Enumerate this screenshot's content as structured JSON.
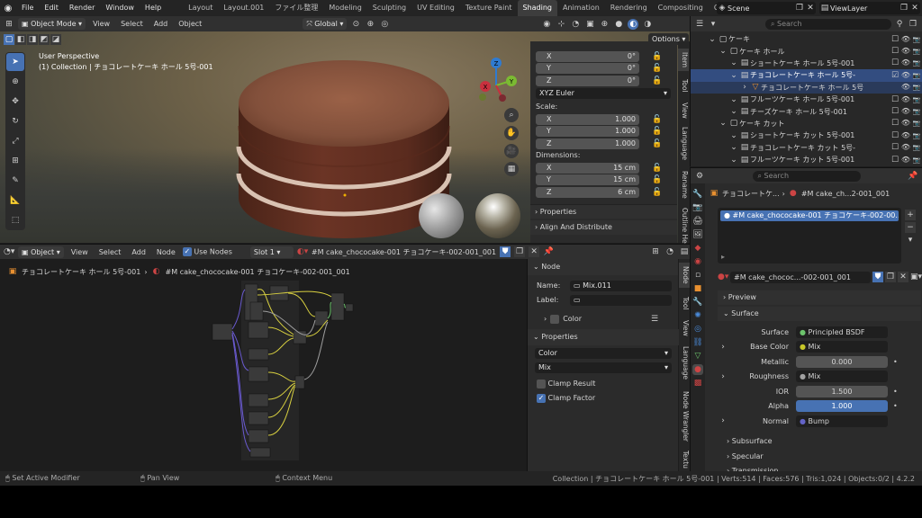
{
  "menu": [
    "File",
    "Edit",
    "Render",
    "Window",
    "Help"
  ],
  "workspace_tabs": [
    "Layout",
    "Layout.001",
    "ファイル整理",
    "Modeling",
    "Sculpting",
    "UV Editing",
    "Texture Paint",
    "Shading",
    "Animation",
    "Rendering",
    "Compositing",
    "Geometry Nodes"
  ],
  "active_tab": "Shading",
  "scene": {
    "label": "Scene",
    "view_layer": "ViewLayer"
  },
  "viewport": {
    "mode": "Object Mode",
    "menus": [
      "View",
      "Select",
      "Add",
      "Object"
    ],
    "orientation": "Global",
    "perspective": "User Perspective",
    "collection_info": "(1) Collection | チョコレートケーキ ホール 5号-001",
    "options": "Options",
    "gizmo": {
      "x": "X",
      "y": "Y",
      "z": "Z"
    }
  },
  "npanel": {
    "rotation": [
      {
        "axis": "X",
        "value": "0°"
      },
      {
        "axis": "Y",
        "value": "0°"
      },
      {
        "axis": "Z",
        "value": "0°"
      }
    ],
    "rotation_mode": "XYZ Euler",
    "scale_label": "Scale:",
    "scale": [
      {
        "axis": "X",
        "value": "1.000"
      },
      {
        "axis": "Y",
        "value": "1.000"
      },
      {
        "axis": "Z",
        "value": "1.000"
      }
    ],
    "dimensions_label": "Dimensions:",
    "dimensions": [
      {
        "axis": "X",
        "value": "15 cm"
      },
      {
        "axis": "Y",
        "value": "15 cm"
      },
      {
        "axis": "Z",
        "value": "6 cm"
      }
    ],
    "properties": "Properties",
    "align": "Align And Distribute",
    "tabs": [
      "Item",
      "Tool",
      "View",
      "Language",
      "Rename",
      "Outline He"
    ]
  },
  "outliner": {
    "search_placeholder": "Search",
    "rows": [
      {
        "indent": 0,
        "text": "ケーキ",
        "icon": "collection"
      },
      {
        "indent": 1,
        "text": "ケーキ ホール",
        "icon": "collection"
      },
      {
        "indent": 2,
        "text": "ショートケーキ ホール 5号-001",
        "icon": "object"
      },
      {
        "indent": 2,
        "text": "チョコレートケーキ ホール 5号-",
        "icon": "object",
        "selected": true
      },
      {
        "indent": 3,
        "text": "チョコレートケーキ ホール 5号",
        "icon": "material",
        "active": true
      },
      {
        "indent": 2,
        "text": "フルーツケーキ ホール 5号-001",
        "icon": "object"
      },
      {
        "indent": 2,
        "text": "チーズケーキ ホール 5号-001",
        "icon": "object"
      },
      {
        "indent": 1,
        "text": "ケーキ カット",
        "icon": "collection"
      },
      {
        "indent": 2,
        "text": "ショートケーキ カット 5号-001",
        "icon": "object"
      },
      {
        "indent": 2,
        "text": "チョコレートケーキ カット 5号-",
        "icon": "object"
      },
      {
        "indent": 2,
        "text": "フルーツケーキ カット 5号-001",
        "icon": "object"
      },
      {
        "indent": 2,
        "text": "チーズケーキ カット 5号-001",
        "icon": "object"
      }
    ]
  },
  "properties": {
    "search_placeholder": "Search",
    "breadcrumb_obj": "チョコレートケ...",
    "breadcrumb_mat": "#M cake_ch...2-001_001",
    "slot": "#M cake_chococake-001 チョコケーキ-002-00...",
    "material_name": "#M cake_chococ...-002-001_001",
    "preview": "Preview",
    "surface": "Surface",
    "fields": [
      {
        "label": "Surface",
        "value": "Principled BSDF",
        "dot": "#6cc36c",
        "kind": "node"
      },
      {
        "label": "Base Color",
        "value": "Mix",
        "dot": "#c7c729",
        "kind": "node"
      },
      {
        "label": "Metallic",
        "value": "0.000",
        "kind": "num"
      },
      {
        "label": "Roughness",
        "value": "Mix",
        "dot": "#a1a1a1",
        "kind": "node"
      },
      {
        "label": "IOR",
        "value": "1.500",
        "kind": "num"
      },
      {
        "label": "Alpha",
        "value": "1.000",
        "kind": "blue"
      },
      {
        "label": "Normal",
        "value": "Bump",
        "dot": "#6363c7",
        "kind": "node"
      }
    ],
    "subsections": [
      "Subsurface",
      "Specular",
      "Transmission"
    ]
  },
  "node_editor": {
    "type": "Object",
    "menus": [
      "View",
      "Select",
      "Add",
      "Node"
    ],
    "use_nodes": "Use Nodes",
    "slot": "Slot 1",
    "material": "#M cake_chococake-001 チョコケーキ-002-001_001",
    "breadcrumb_obj": "チョコレートケーキ ホール 5号-001",
    "breadcrumb_mat": "#M cake_chococake-001 チョコケーキ-002-001_001"
  },
  "node_panel": {
    "title": "Node",
    "name_label": "Name:",
    "name_value": "Mix.011",
    "label_label": "Label:",
    "color": "Color",
    "properties": "Properties",
    "data_type": "Color",
    "blend": "Mix",
    "clamp_result": "Clamp Result",
    "clamp_factor": "Clamp Factor",
    "tabs": [
      "Node",
      "Tool",
      "View",
      "Language",
      "Node Wrangler",
      "Textu"
    ]
  },
  "statusbar": {
    "left": [
      "Set Active Modifier",
      "Pan View",
      "Context Menu"
    ],
    "right": "Collection | チョコレートケーキ ホール 5号-001 | Verts:514 | Faces:576 | Tris:1,024 | Objects:0/2 | 4.2.2"
  }
}
